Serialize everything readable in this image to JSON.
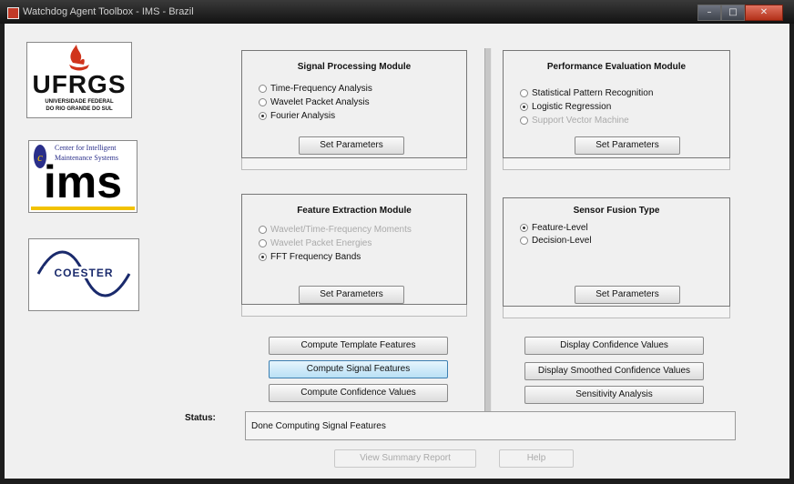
{
  "window": {
    "title": "Watchdog Agent Toolbox - IMS - Brazil"
  },
  "logos": {
    "ufrgs": {
      "name": "UFRGS",
      "subtitle_line1": "UNIVERSIDADE FEDERAL",
      "subtitle_line2": "DO RIO GRANDE DO SUL"
    },
    "ims": {
      "caption_line1": "Center for Intelligent",
      "caption_line2": "Maintenance Systems",
      "name": "ims"
    },
    "coester": {
      "name": "COESTER"
    }
  },
  "signal_processing": {
    "title": "Signal Processing Module",
    "options": [
      {
        "label": "Time-Frequency Analysis",
        "selected": false,
        "enabled": true
      },
      {
        "label": "Wavelet Packet Analysis",
        "selected": false,
        "enabled": true
      },
      {
        "label": "Fourier Analysis",
        "selected": true,
        "enabled": true
      }
    ],
    "button": "Set Parameters"
  },
  "performance_evaluation": {
    "title": "Performance Evaluation Module",
    "options": [
      {
        "label": "Statistical Pattern Recognition",
        "selected": false,
        "enabled": true
      },
      {
        "label": "Logistic Regression",
        "selected": true,
        "enabled": true
      },
      {
        "label": "Support Vector Machine",
        "selected": false,
        "enabled": false
      }
    ],
    "button": "Set Parameters"
  },
  "feature_extraction": {
    "title": "Feature Extraction Module",
    "options": [
      {
        "label": "Wavelet/Time-Frequency Moments",
        "selected": false,
        "enabled": false
      },
      {
        "label": "Wavelet Packet Energies",
        "selected": false,
        "enabled": false
      },
      {
        "label": "FFT Frequency Bands",
        "selected": true,
        "enabled": true
      }
    ],
    "button": "Set Parameters"
  },
  "sensor_fusion": {
    "title": "Sensor Fusion Type",
    "options": [
      {
        "label": "Feature-Level",
        "selected": true,
        "enabled": true
      },
      {
        "label": "Decision-Level",
        "selected": false,
        "enabled": true
      }
    ],
    "button": "Set Parameters"
  },
  "actions": {
    "compute_template": "Compute Template Features",
    "compute_signal": "Compute Signal Features",
    "compute_confidence": "Compute Confidence Values",
    "display_confidence": "Display Confidence Values",
    "display_smoothed": "Display Smoothed Confidence Values",
    "sensitivity": "Sensitivity Analysis"
  },
  "status": {
    "label": "Status:",
    "text": "Done Computing Signal Features"
  },
  "footer": {
    "summary": "View Summary Report",
    "help": "Help"
  },
  "colors": {
    "accent_red": "#d0341c",
    "ims_yellow": "#f2c200",
    "focus_blue": "#b9e0f5"
  }
}
